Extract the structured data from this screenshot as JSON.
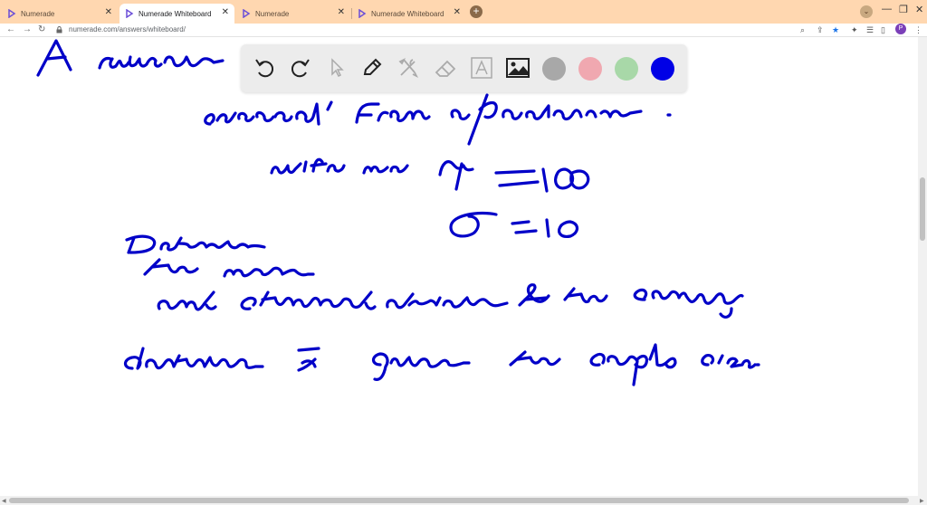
{
  "browser": {
    "tabs": [
      {
        "label": "Numerade",
        "active": false
      },
      {
        "label": "Numerade Whiteboard",
        "active": true
      },
      {
        "label": "Numerade",
        "active": false
      },
      {
        "label": "Numerade Whiteboard",
        "active": false
      }
    ],
    "url": "numerade.com/answers/whiteboard/",
    "profile_initial": "P",
    "accent_tabbar": "#ffd7b0"
  },
  "toolbar": {
    "tools": [
      "undo-icon",
      "redo-icon",
      "select-icon",
      "pen-icon",
      "tools-icon",
      "eraser-icon",
      "text-icon",
      "image-icon"
    ],
    "colors": [
      "#a8a8a8",
      "#f0a8b0",
      "#a8d8a8",
      "#0000e6"
    ],
    "selected_color": "#0000e6"
  },
  "whiteboard": {
    "ink_color": "#0000c8",
    "handwriting_lines": [
      "A random",
      "selected from a population",
      "with mean μ = 100",
      "σ = 10",
      "Determine",
      "the mean",
      "and standard deviation of the sampling",
      "distribution x̄ given the sample sizes."
    ]
  }
}
